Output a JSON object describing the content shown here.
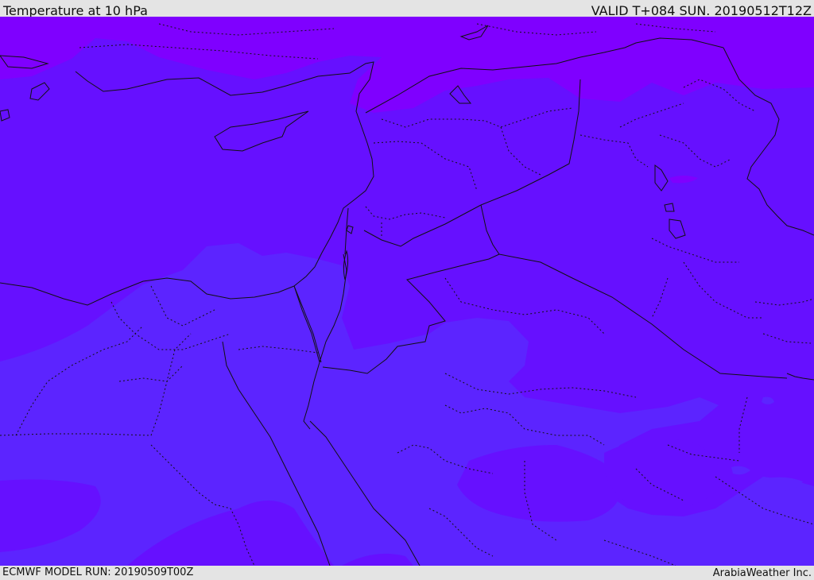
{
  "header": {
    "title": "Temperature at 10 hPa",
    "valid_time": "VALID T+084 SUN. 20190512T12Z"
  },
  "footer": {
    "model_run": "ECMWF MODEL RUN: 20190509T00Z",
    "credit": "ArabiaWeather Inc."
  },
  "colors": {
    "band_cold": "#7f00ff",
    "band_mid": "#6610ff",
    "band_warm": "#5c24ff",
    "coastline": "#111111",
    "border": "#111111"
  }
}
